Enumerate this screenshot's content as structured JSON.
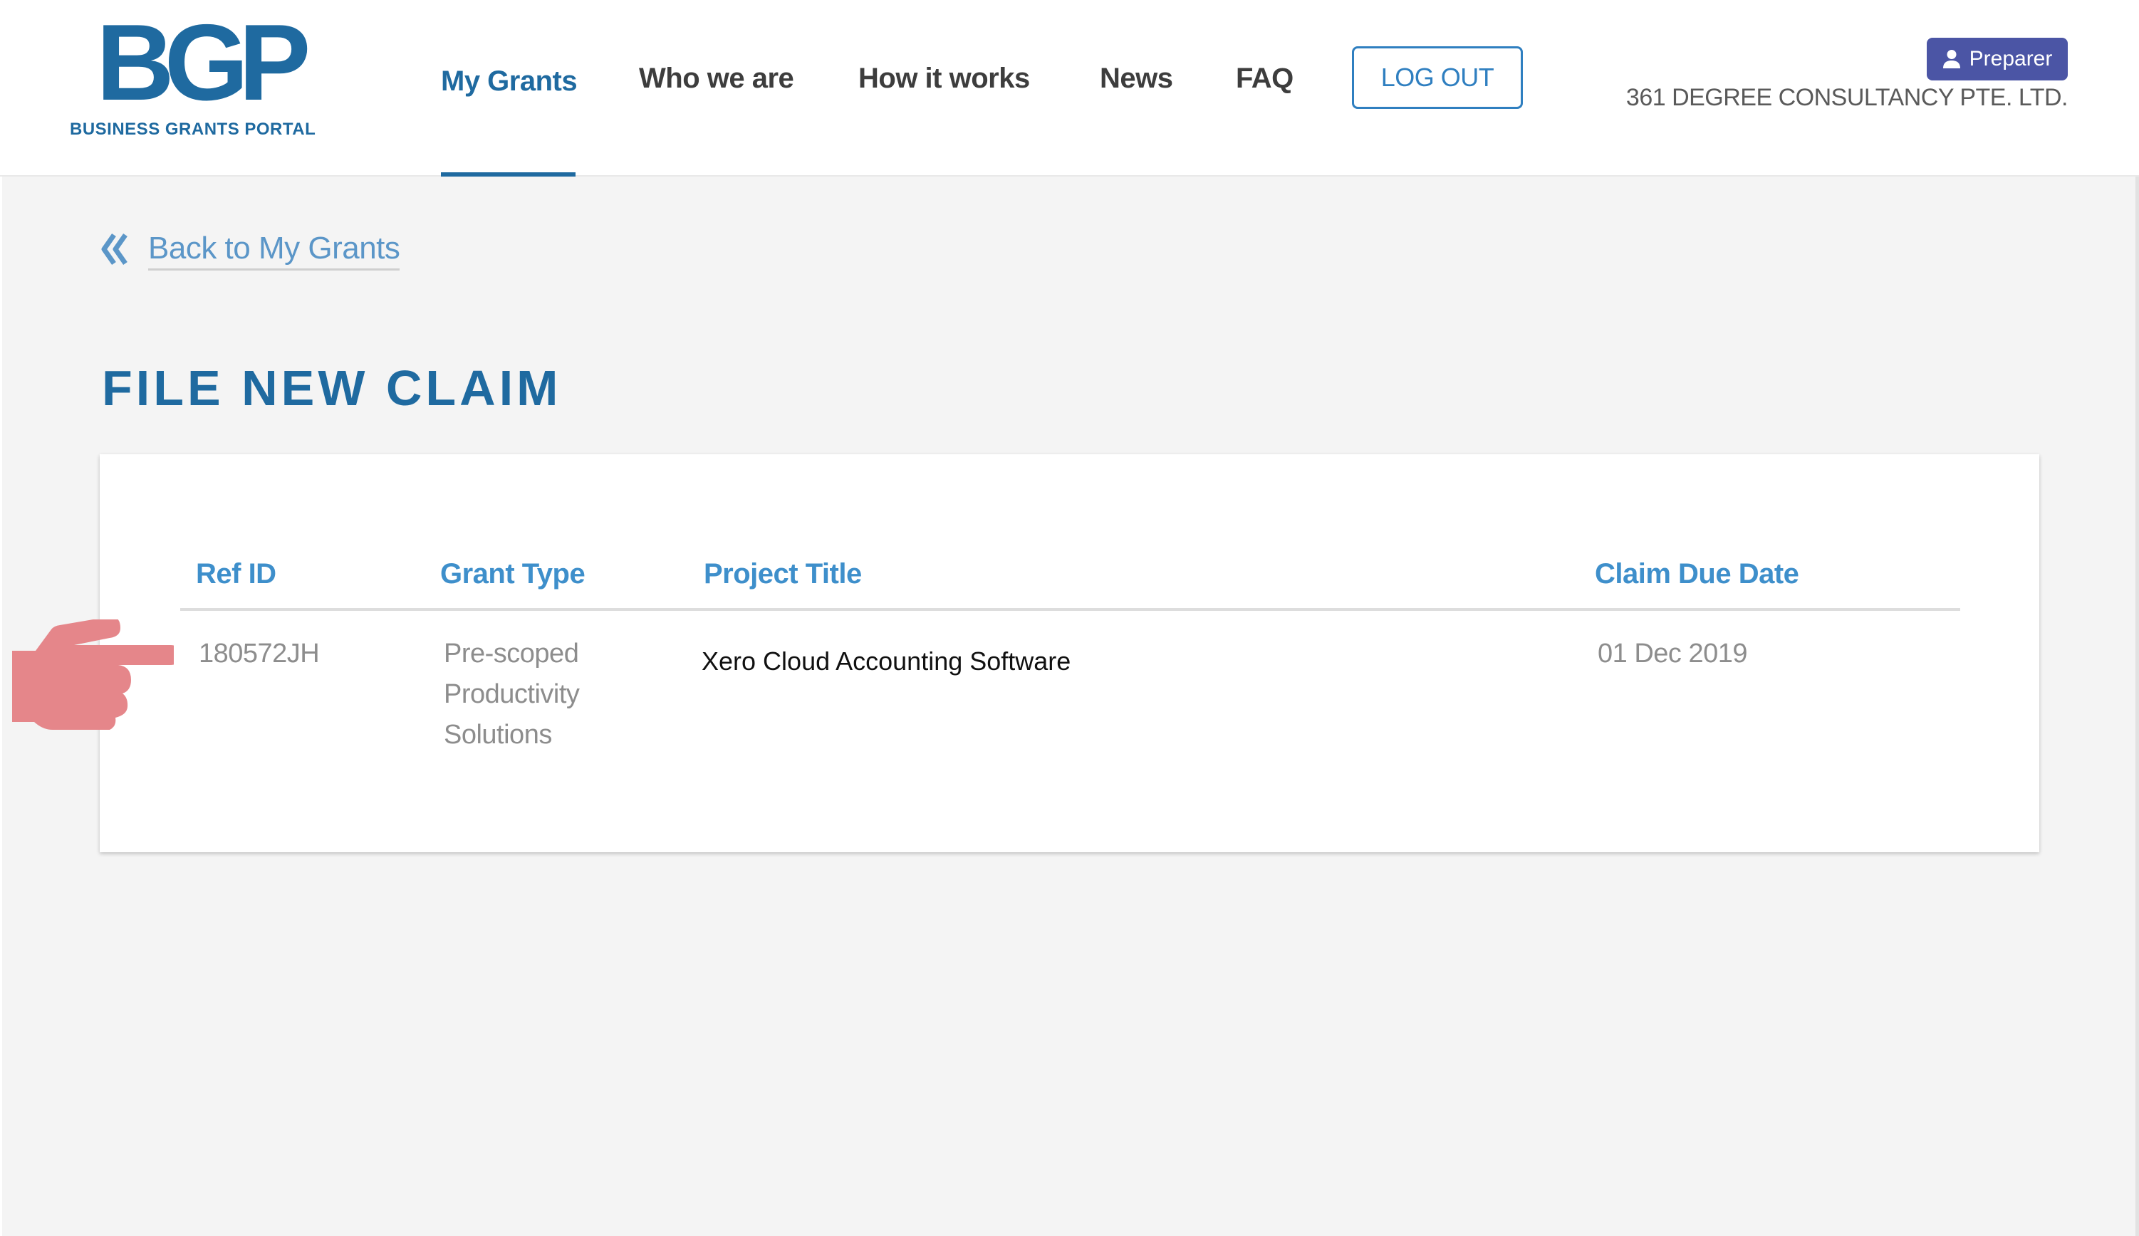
{
  "app": {
    "logo_mark": "BGP",
    "logo_subtitle": "BUSINESS GRANTS PORTAL"
  },
  "nav": {
    "items": [
      {
        "label": "My Grants",
        "active": true
      },
      {
        "label": "Who we are",
        "active": false
      },
      {
        "label": "How it works",
        "active": false
      },
      {
        "label": "News",
        "active": false
      },
      {
        "label": "FAQ",
        "active": false
      }
    ],
    "logout_label": "LOG OUT"
  },
  "user": {
    "role_label": "Preparer",
    "role_icon": "user-icon",
    "company": "361 DEGREE CONSULTANCY PTE. LTD."
  },
  "back_link": {
    "icon": "double-chevron-left-icon",
    "label": "Back to My Grants"
  },
  "page": {
    "title": "FILE NEW CLAIM"
  },
  "table": {
    "columns": [
      "Ref ID",
      "Grant Type",
      "Project Title",
      "Claim Due Date"
    ],
    "rows": [
      {
        "ref_id": "180572JH",
        "grant_type_lines": [
          "Pre-scoped",
          "Productivity",
          "Solutions"
        ],
        "project_title": "Xero Cloud Accounting Software",
        "claim_due_date": "01 Dec 2019"
      }
    ]
  },
  "annotation": {
    "icon": "pointing-hand-icon",
    "color": "#e5868a"
  },
  "colors": {
    "brand": "#1f6aa0",
    "link": "#5b96c8",
    "column_header": "#3e8fcb",
    "role_badge": "#4b55a5",
    "background": "#f4f4f4"
  }
}
